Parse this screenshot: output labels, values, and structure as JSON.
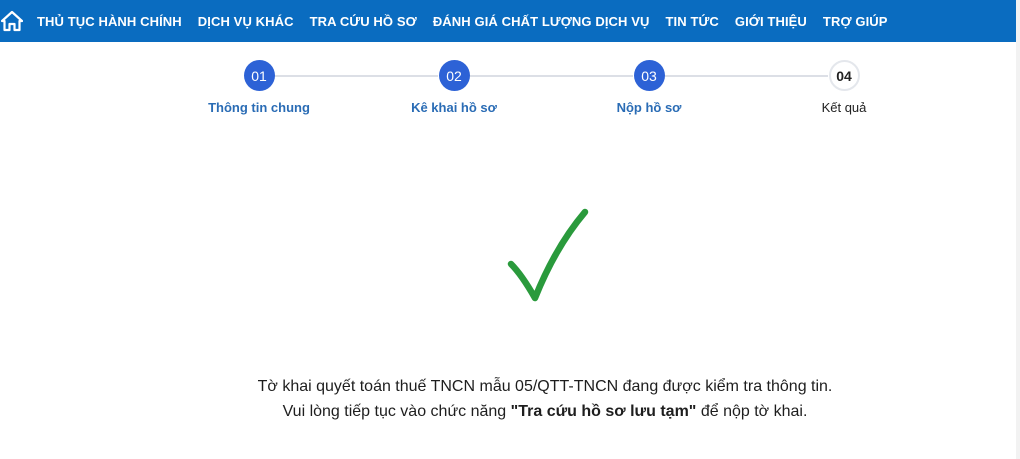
{
  "navbar": {
    "home_icon": "home-icon",
    "items": [
      {
        "label": "THỦ TỤC HÀNH CHÍNH"
      },
      {
        "label": "DỊCH VỤ KHÁC"
      },
      {
        "label": "TRA CỨU HỒ SƠ"
      },
      {
        "label": "ĐÁNH GIÁ CHẤT LƯỢNG DỊCH VỤ"
      },
      {
        "label": "TIN TỨC"
      },
      {
        "label": "GIỚI THIỆU"
      },
      {
        "label": "TRỢ GIÚP"
      }
    ]
  },
  "stepper": {
    "steps": [
      {
        "number": "01",
        "label": "Thông tin chung",
        "state": "done"
      },
      {
        "number": "02",
        "label": "Kê khai hồ sơ",
        "state": "done"
      },
      {
        "number": "03",
        "label": "Nộp hồ sơ",
        "state": "done"
      },
      {
        "number": "04",
        "label": "Kết quả",
        "state": "current"
      }
    ]
  },
  "result": {
    "icon": "checkmark-icon",
    "line1": "Tờ khai quyết toán thuế TNCN mẫu 05/QTT-TNCN đang được kiểm tra thông tin.",
    "line2_prefix": "Vui lòng tiếp tục vào chức năng ",
    "line2_bold": "\"Tra cứu hồ sơ lưu tạm\"",
    "line2_suffix": " để nộp tờ khai."
  },
  "colors": {
    "navbar_bg": "#0a6cc0",
    "step_done": "#2d62d6",
    "step_label": "#2a6cb5",
    "check_green": "#2a9a3c"
  }
}
